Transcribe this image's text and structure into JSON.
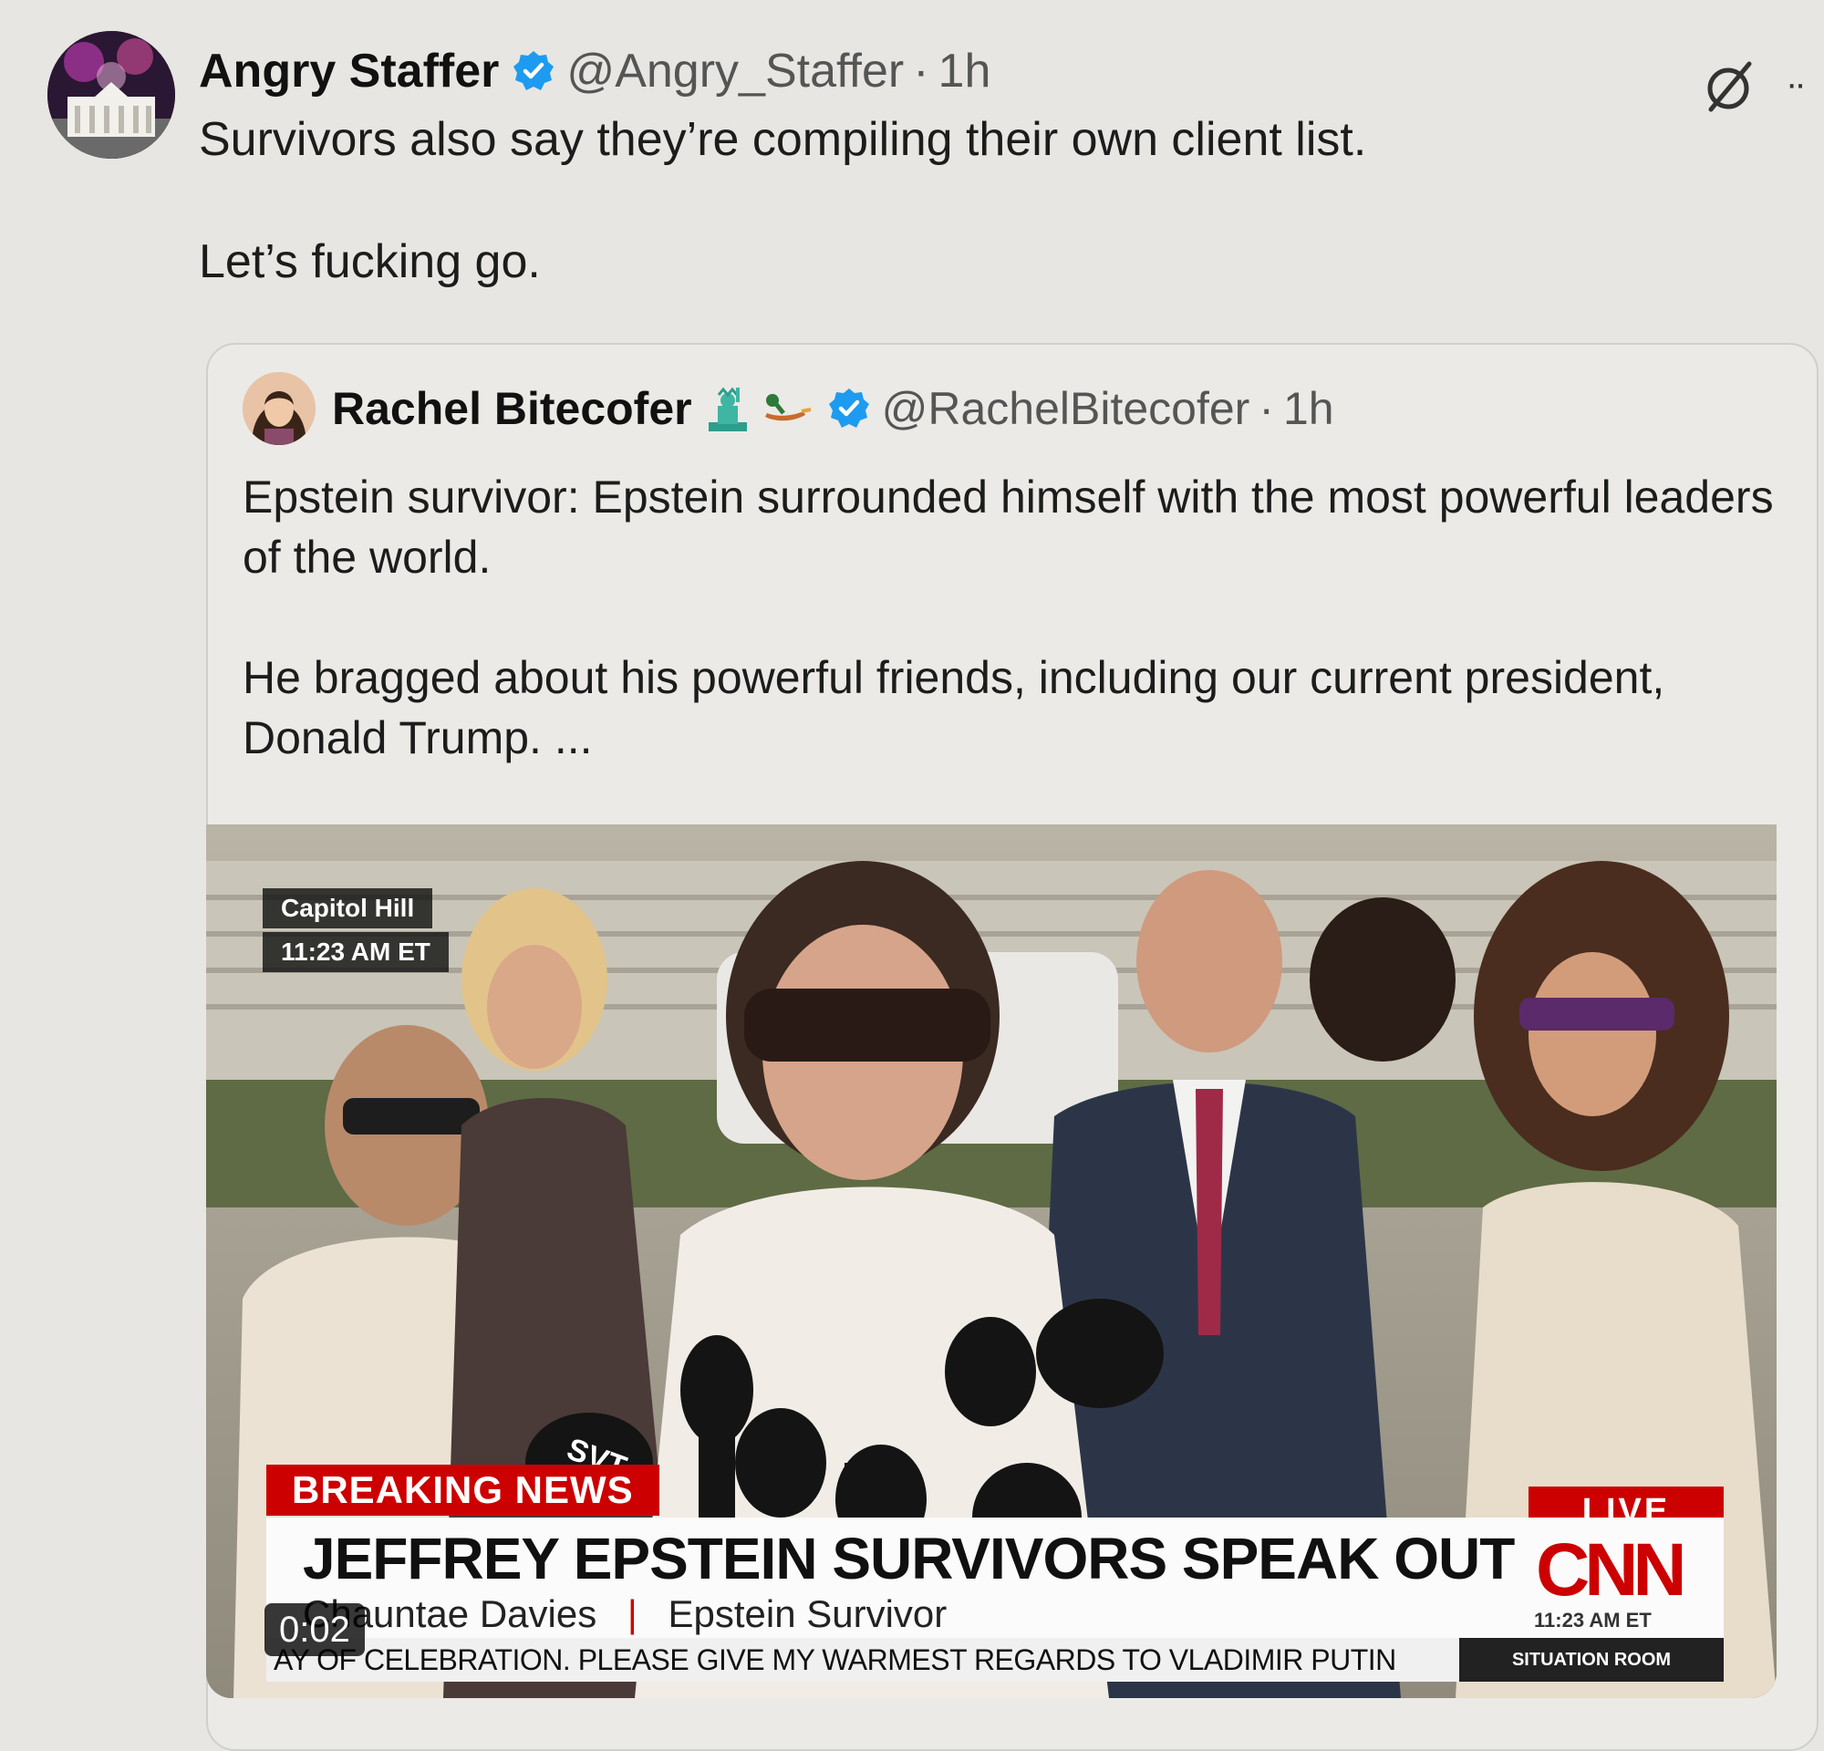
{
  "tweet": {
    "author_name": "Angry Staffer",
    "handle": "@Angry_Staffer",
    "separator": "·",
    "time": "1h",
    "text_line1": "Survivors also say they’re compiling their own client list.",
    "text_line2": "Let’s fucking go.",
    "more_label": "··"
  },
  "quoted": {
    "author_name": "Rachel Bitecofer",
    "handle": "@RachelBitecofer",
    "separator": "·",
    "time": "1h",
    "emojis": [
      "statue-of-liberty-emoji",
      "duck-emoji"
    ],
    "text_p1": "Epstein survivor: Epstein surrounded himself with the most powerful leaders of the world.",
    "text_p2": "He bragged about his powerful friends, including our current president, Donald Trump. ..."
  },
  "video": {
    "location": "Capitol Hill",
    "location_time": "11:23 AM ET",
    "breaking": "BREAKING NEWS",
    "live": "LIVE",
    "headline": "JEFFREY EPSTEIN SURVIVORS SPEAK OUT",
    "speaker_name": "Chauntae Davies",
    "speaker_sep": "|",
    "speaker_title": "Epstein Survivor",
    "network": "CNN",
    "network_time": "11:23 AM ET",
    "ticker": "AY OF CELEBRATION. PLEASE GIVE MY WARMEST REGARDS TO VLADIMIR PUTIN",
    "show": "SITUATION ROOM",
    "elapsed": "0:02",
    "mic_label": "SVT"
  },
  "colors": {
    "verified": "#1d9bf0",
    "cnn_red": "#cc0000",
    "background": "#e7e6e2"
  }
}
